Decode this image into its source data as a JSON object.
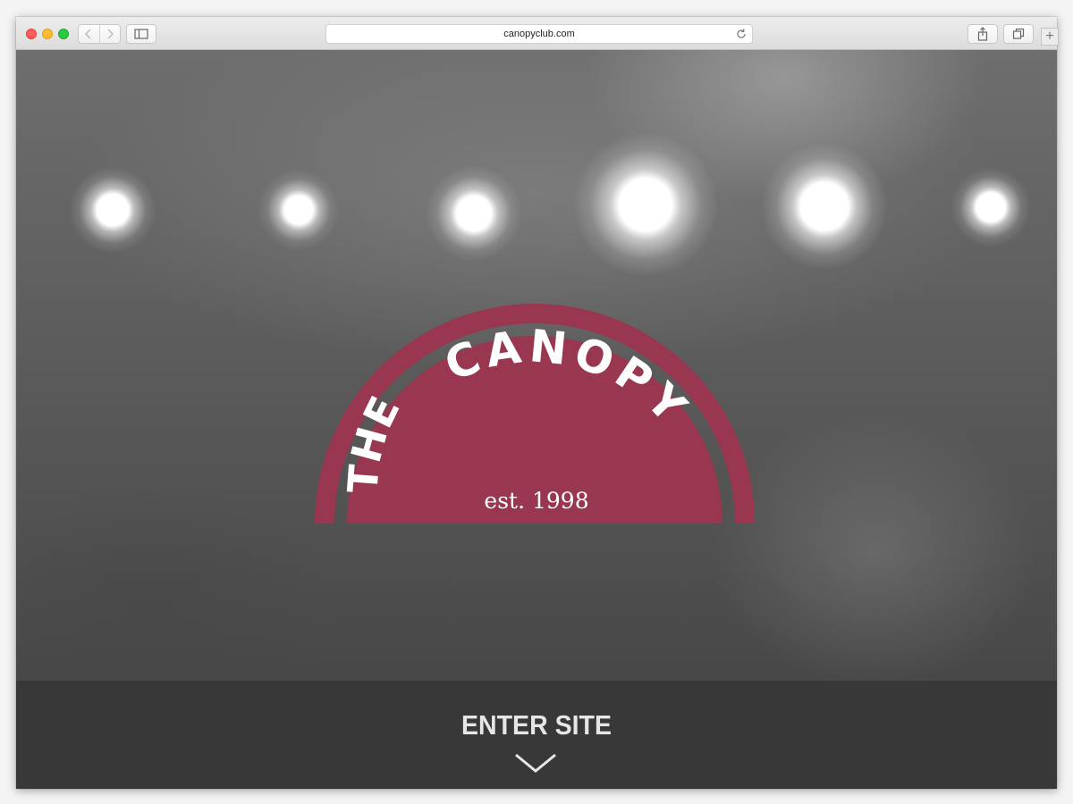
{
  "browser": {
    "url": "canopyclub.com"
  },
  "logo": {
    "arc_text_left": "THE",
    "arc_text_main": "CANOPY",
    "established": "est. 1998",
    "color": "#993650"
  },
  "enter": {
    "label": "ENTER SITE"
  },
  "icons": {
    "back": "chevron-left-icon",
    "forward": "chevron-right-icon",
    "sidebar": "sidebar-icon",
    "reload": "reload-icon",
    "share": "share-icon",
    "tabs": "tabs-icon",
    "new_tab": "plus-icon",
    "enter": "chevron-down-icon"
  }
}
